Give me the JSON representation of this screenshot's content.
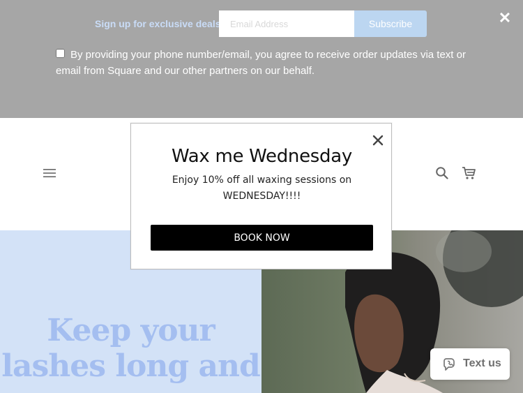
{
  "signup": {
    "label": "Sign up for exclusive deals!",
    "email_placeholder": "Email Address",
    "email_value": "",
    "subscribe_label": "Subscribe",
    "close_glyph": "✕",
    "consent_text": "By providing your phone number/email, you agree to receive order updates via text or email from Square and our other partners on our behalf.",
    "colors": {
      "background": "#a6a6a6",
      "label": "#c9dcf7",
      "subscribe": "#bcd6f1"
    }
  },
  "header": {
    "icons": {
      "menu": "menu-icon",
      "search": "search-icon",
      "cart": "cart-icon"
    }
  },
  "modal": {
    "title": "Wax me Wednesday",
    "description": "Enjoy 10% off all waxing sessions on WEDNESDAY!!!!",
    "button_label": "BOOK NOW",
    "close_icon": "close-icon"
  },
  "hero": {
    "heading": "Keep your lashes long and",
    "colors": {
      "panel": "#d3e2f7",
      "heading": "#a4bef0"
    }
  },
  "text_us": {
    "label": "Text us",
    "icon": "chat-phone-icon"
  }
}
